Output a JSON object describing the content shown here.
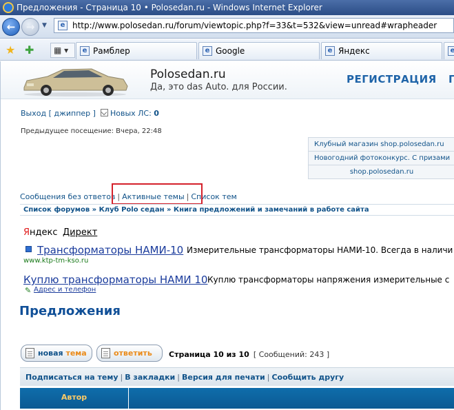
{
  "window": {
    "title": "Предложения - Страница 10 • Polosedan.ru - Windows Internet Explorer",
    "url": "http://www.polosedan.ru/forum/viewtopic.php?f=33&t=532&view=unread#wrapheader"
  },
  "tabs": [
    {
      "label": "Рамблер"
    },
    {
      "label": "Google"
    },
    {
      "label": "Яндекс"
    }
  ],
  "site": {
    "name": "Polosedan.ru",
    "slogan": "Да, это das Auto. для России.",
    "register": "РЕГИСТРАЦИЯ",
    "register_extra": "Г"
  },
  "user": {
    "logout": "Выход [ джиппер ]",
    "new_pm_label": "Новых ЛС:",
    "new_pm_count": "0",
    "last_visit": "Предыдущее посещение: Вчера, 22:48"
  },
  "shop": [
    "Клубный магазин shop.polosedan.ru",
    "Новогодний фотоконкурс. С призами",
    "shop.polosedan.ru"
  ],
  "quicklinks": {
    "unanswered": "Сообщения без ответов",
    "active": "Активные темы",
    "topics": "Список тем"
  },
  "breadcrumbs": {
    "text": "Список форумов » Клуб Polo седан » Книга предложений и замечаний в работе сайта"
  },
  "ads": {
    "yandex_ya": "Я",
    "yandex_rest": "ндекс",
    "direct": "Директ",
    "ad1_title": "Трансформаторы НАМИ-10",
    "ad1_desc": "Измерительные трансформаторы НАМИ-10. Всегда в наличи",
    "ad1_url": "www.ktp-tm-kso.ru",
    "ad2_title": "Куплю трансформаторы НАМИ 10",
    "ad2_desc": "Куплю трансформаторы напряжения измерительные с",
    "ad2_addr": "Адрес и телефон"
  },
  "forum": {
    "title": "Предложения",
    "new_topic_a": "новая ",
    "new_topic_b": "тема",
    "reply": "ответить",
    "page_text": "Страница 10 из 10",
    "post_count": "[ Сообщений: 243 ]",
    "actions": [
      "Подписаться на тему",
      "В закладки",
      "Версия для печати",
      "Сообщить другу"
    ],
    "col_author": "Автор"
  },
  "colors": {
    "link": "#105289",
    "accent_orange": "#ea8b1a",
    "highlight_red": "#d4202a",
    "table_header": "#0f6dab"
  }
}
